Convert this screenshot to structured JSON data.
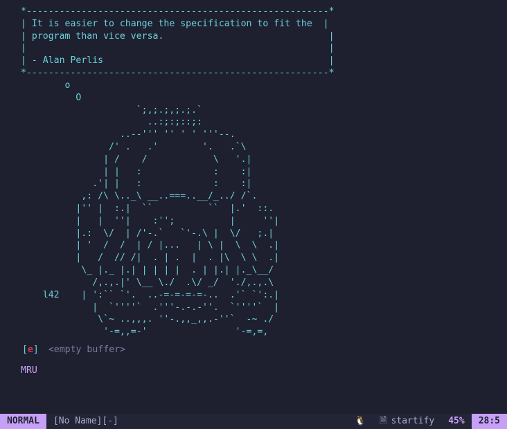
{
  "fortune": {
    "top": "*-------------------------------------------------------*",
    "line1": "| It is easier to change the specification to fit the  |",
    "line2": "| program than vice versa.                              |",
    "blank": "|                                                       |",
    "attr": "| - Alan Perlis                                         |",
    "bottom": "*-------------------------------------------------------*"
  },
  "ascii_art": [
    "        o",
    "          O",
    "                     `;,;.;,;.;.`",
    "                       ..:;:;::;:",
    "                  ..--''' '' ' ' '''--.",
    "                /' .   .'        '.   .`\\",
    "               | /    /            \\   '.|",
    "               | |   :             :    :|",
    "             .'| |   :             :    :|",
    "           ,: /\\ \\.._\\ __..===..__/_../ /`.",
    "          |'' |  :.|  ``          ``  |.'  ::.",
    "          |   |  ''|    :'';          |     ''|",
    "          |.:  \\/  | /'-.`   `'-.\\ |  \\/   ;.|",
    "          | '  /  /  | / |...   | \\ |  \\  \\  .|",
    "          |   /  // /|  . | .  |  . |\\  \\ \\  .|",
    "           \\_ |._ |.| | | | |  . | |.| |._\\__/",
    "             /,.,.|' \\__ \\./  .\\/ _/  './,.,.\\",
    "    l42    | ':`` `'.  ..-=-=-=-=-..  .'` `':.|",
    "             |  `''''`  .'''-.-.-''.  `''''`  |",
    "              \\`~ ..,,,. ''-.,,_,,.-''`  -~ ./",
    "               '-=,,=-'                '-=,=,"
  ],
  "buffer": {
    "bracket_open": "[",
    "key": "e",
    "bracket_close": "]",
    "label": "<empty buffer>"
  },
  "section": {
    "mru": "MRU"
  },
  "statusline": {
    "mode": "NORMAL",
    "file": "[No Name][-]",
    "os_icon": "🐧",
    "doc_icon": "🗎",
    "filetype": "startify",
    "percent": "45%",
    "position": "28:5"
  }
}
